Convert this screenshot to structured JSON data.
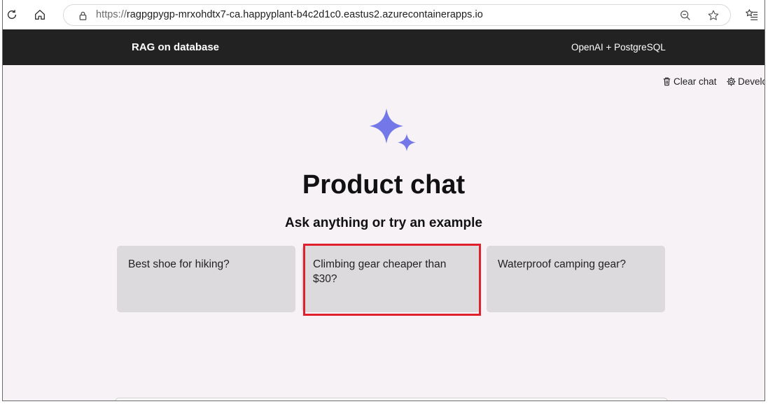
{
  "browser": {
    "url_protocol": "https://",
    "url_host": "ragpgpygp-mrxohdtx7-ca.happyplant-b4c2d1c0.eastus2.azurecontainerapps.io",
    "icons": [
      "refresh-icon",
      "home-icon",
      "lock-icon",
      "zoom-out-icon",
      "star-icon",
      "favorites-list-icon"
    ]
  },
  "header": {
    "title": "RAG on database",
    "subtitle": "OpenAI + PostgreSQL",
    "background": "#222222"
  },
  "toolbar": {
    "clear_chat_label": "Clear chat",
    "developer_label": "Develop"
  },
  "main": {
    "title": "Product chat",
    "subtitle": "Ask anything or try an example",
    "examples": [
      {
        "label": "Best shoe for hiking?"
      },
      {
        "label": "Climbing gear cheaper than $30?"
      },
      {
        "label": "Waterproof camping gear?"
      }
    ],
    "highlighted_example": 1,
    "highlight_color": "#e0202c",
    "sparkle_color": "#7377e8"
  }
}
